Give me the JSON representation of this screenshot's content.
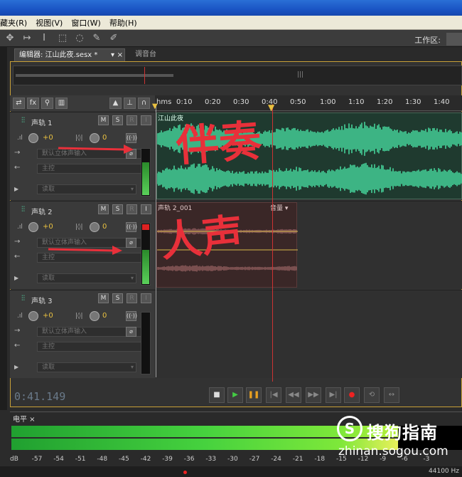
{
  "menu": {
    "items": [
      "藏夹(R)",
      "视图(V)",
      "窗口(W)",
      "帮助(H)"
    ]
  },
  "toolbar": {
    "workspace_label": "工作区:"
  },
  "tabs": {
    "editor": "编辑器: 江山此夜.sesx *",
    "mixer": "调音台"
  },
  "ruler": {
    "labels": [
      "hms",
      "0:10",
      "0:20",
      "0:30",
      "0:40",
      "0:50",
      "1:00",
      "1:10",
      "1:20",
      "1:30",
      "1:40"
    ]
  },
  "tracks": [
    {
      "name": "声轨 1",
      "volume": "+0",
      "pan": "0",
      "input": "默认立体声输入",
      "output": "主控",
      "automation": "读取",
      "clip_title": "江山此夜"
    },
    {
      "name": "声轨 2",
      "volume": "+0",
      "pan": "0",
      "input": "默认立体声输入",
      "output": "主控",
      "automation": "读取",
      "clip_title": "声轨 2_001",
      "clip_param": "音量"
    },
    {
      "name": "声轨 3",
      "volume": "+0",
      "pan": "0",
      "input": "默认立体声输入",
      "output": "主控",
      "automation": "读取"
    }
  ],
  "track_buttons": {
    "mute": "M",
    "solo": "S",
    "arm": "R",
    "monitor": "I"
  },
  "transport": {
    "timecode": "0:41.149"
  },
  "level_panel": {
    "title": "电平",
    "db_scale": [
      "dB",
      "-57",
      "-54",
      "-51",
      "-48",
      "-45",
      "-42",
      "-39",
      "-36",
      "-33",
      "-30",
      "-27",
      "-24",
      "-21",
      "-18",
      "-15",
      "-12",
      "-9",
      "-6",
      "-3"
    ],
    "left_level_fraction": 0.84,
    "right_level_fraction": 0.84
  },
  "status": {
    "sample_rate": "44100 Hz"
  },
  "watermark": {
    "logo": "S",
    "text": "搜狗指南",
    "url": "zhinan.sogou.com"
  },
  "annotations": {
    "accompaniment": "伴奏",
    "vocal": "人声"
  },
  "colors": {
    "waveform": "#45d39a",
    "playhead": "#cc3333",
    "clip1_bg": "#1f3a2f",
    "clip2_bg": "#3a2727",
    "annotation": "#e8303a"
  }
}
